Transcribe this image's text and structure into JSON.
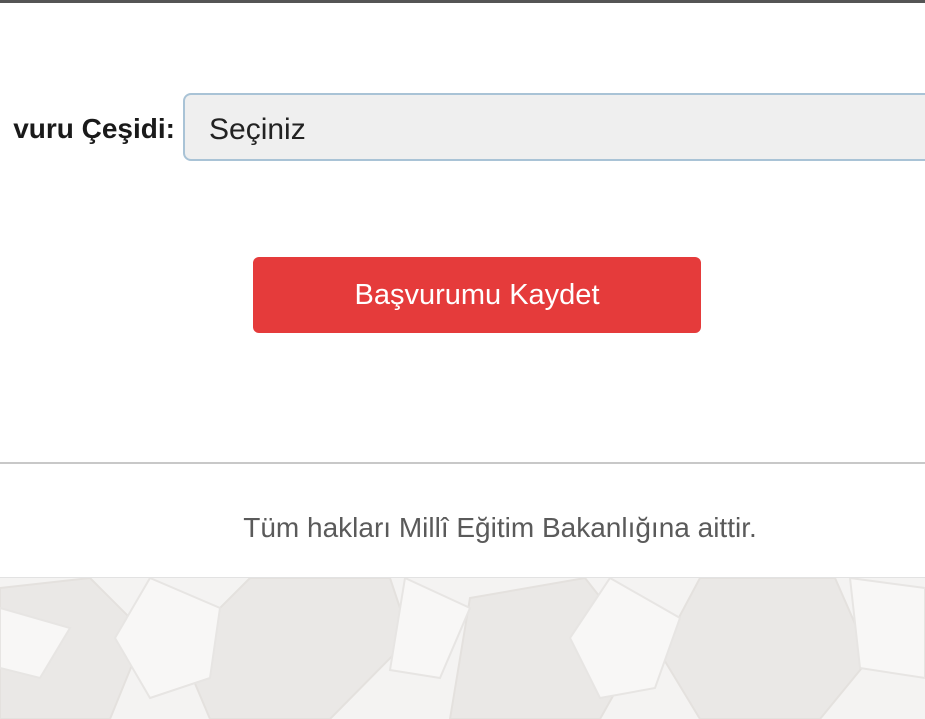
{
  "form": {
    "application_type_label": "vuru Çeşidi:",
    "application_type_value": "Seçiniz",
    "submit_label": "Başvurumu Kaydet"
  },
  "footer": {
    "copyright": "Tüm hakları Millî Eğitim Bakanlığına aittir."
  },
  "colors": {
    "primary_button": "#e53b3b",
    "select_border": "#a9c3d6",
    "select_background": "#efefef",
    "footer_text": "#5a5a5a"
  }
}
